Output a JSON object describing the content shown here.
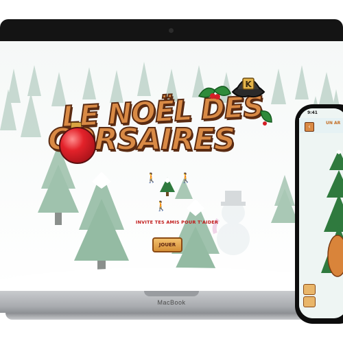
{
  "laptop": {
    "brand_label": "MacBook"
  },
  "game": {
    "title_line_1": "LE NOËL DES",
    "title_line_2": "CORSAIRES",
    "invite_text": "INVITE TES AMIS POUR T'AIDER",
    "play_label": "JOUER",
    "hat_letter": "K"
  },
  "phone": {
    "time": "9:41",
    "header_title": "UN AR",
    "back_icon": "arrow-left-icon"
  },
  "colors": {
    "title_orange": "#d98a45",
    "title_outline": "#5a2b12",
    "invite_red": "#c01818",
    "button_orange": "#e6a652"
  }
}
